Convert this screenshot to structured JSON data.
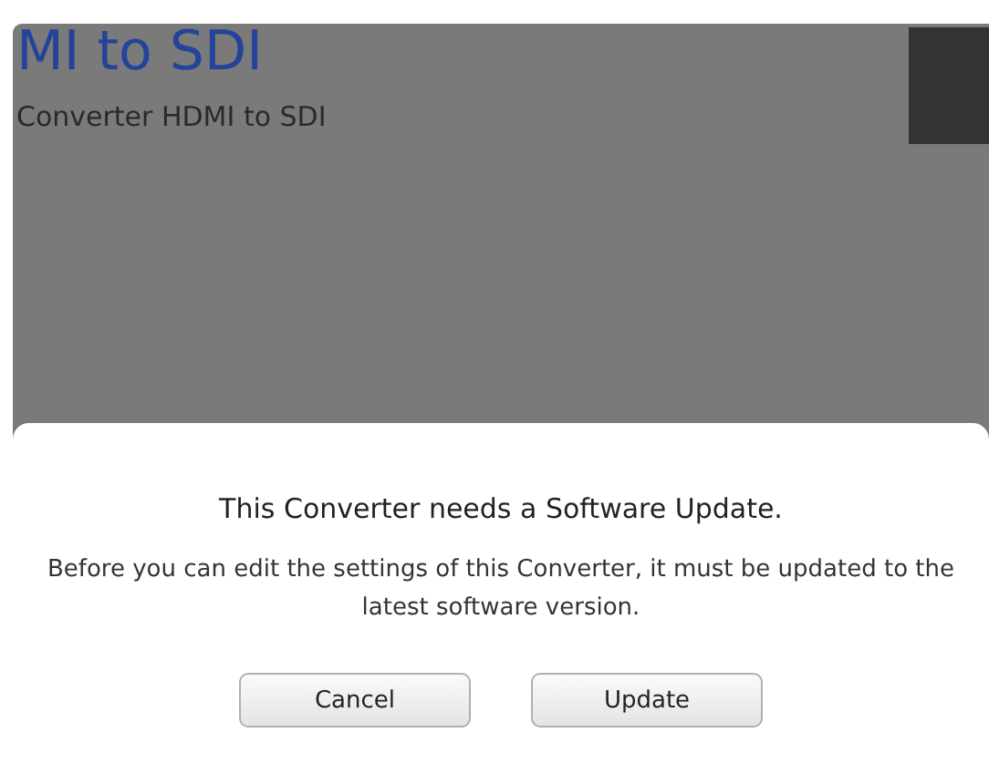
{
  "page": {
    "title": "MI to SDI",
    "subtitle": "Converter HDMI to SDI"
  },
  "dialog": {
    "title": "This Converter needs a Software Update.",
    "message": "Before you can edit the settings of this Converter, it must be updated to the latest software version.",
    "buttons": [
      {
        "label": "Cancel"
      },
      {
        "label": "Update"
      }
    ]
  }
}
